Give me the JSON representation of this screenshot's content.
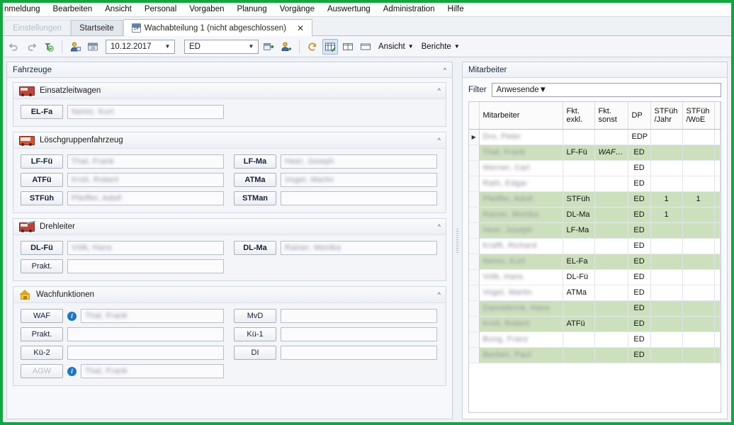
{
  "menu": {
    "items": [
      "nmeldung",
      "Bearbeiten",
      "Ansicht",
      "Personal",
      "Vorgaben",
      "Planung",
      "Vorgänge",
      "Auswertung",
      "Administration",
      "Hilfe"
    ]
  },
  "tabs": [
    {
      "label": "Einstellungen",
      "state": "ghost"
    },
    {
      "label": "Startseite",
      "state": "inactive"
    },
    {
      "label": "Wachabteilung 1 (nicht abgeschlossen)",
      "state": "active",
      "icon": "calendar-icon",
      "icon_number": "14",
      "close": "✕"
    }
  ],
  "toolbar": {
    "date_value": "10.12.2017",
    "shift_value": "ED",
    "arrow": "▼",
    "view_label": "Ansicht",
    "reports_label": "Berichte",
    "icons": [
      "undo-icon",
      "redo-icon",
      "refresh-person-icon",
      "add-person-icon",
      "calendar-assign-icon",
      "forward-day-icon",
      "person-export-icon",
      "reset-icon",
      "grid-view-icon",
      "split-view-icon",
      "single-view-icon"
    ]
  },
  "left_pane": {
    "title": "Fahrzeuge",
    "groups": [
      {
        "title": "Einsatzleitwagen",
        "icon": "fire-truck-icon",
        "rows": [
          [
            {
              "label": "EL-Fa",
              "value": "Nemo, Kurt",
              "bold": true,
              "info": false
            },
            null
          ]
        ]
      },
      {
        "title": "Löschgruppenfahrzeug",
        "icon": "fire-engine-icon",
        "rows": [
          [
            {
              "label": "LF-Fü",
              "value": "Thal, Frank",
              "bold": true,
              "info": false
            },
            {
              "label": "LF-Ma",
              "value": "Heer, Joseph",
              "bold": true,
              "info": false
            }
          ],
          [
            {
              "label": "ATFü",
              "value": "Kroll, Robert",
              "bold": true,
              "info": false
            },
            {
              "label": "ATMa",
              "value": "Vogel, Martin",
              "bold": true,
              "info": false
            }
          ],
          [
            {
              "label": "STFüh",
              "value": "Pfeiffer, Adolf",
              "bold": true,
              "info": false
            },
            {
              "label": "STMan",
              "value": "",
              "bold": true,
              "info": false
            }
          ]
        ]
      },
      {
        "title": "Drehleiter",
        "icon": "turntable-ladder-icon",
        "rows": [
          [
            {
              "label": "DL-Fü",
              "value": "Völk, Hans",
              "bold": true,
              "info": false
            },
            {
              "label": "DL-Ma",
              "value": "Rainer, Monika",
              "bold": true,
              "info": false
            }
          ],
          [
            {
              "label": "Prakt.",
              "value": "",
              "bold": false,
              "info": false
            },
            null
          ]
        ]
      },
      {
        "title": "Wachfunktionen",
        "icon": "house-icon",
        "rows": [
          [
            {
              "label": "WAF",
              "value": "Thal, Frank",
              "bold": false,
              "info": true
            },
            {
              "label": "MvD",
              "value": "",
              "bold": false,
              "info": false
            }
          ],
          [
            {
              "label": "Prakt.",
              "value": "",
              "bold": false,
              "info": false
            },
            {
              "label": "Kü-1",
              "value": "",
              "bold": false,
              "info": false
            }
          ],
          [
            {
              "label": "Kü-2",
              "value": "",
              "bold": false,
              "info": false
            },
            {
              "label": "DI",
              "value": "",
              "bold": false,
              "info": false
            }
          ],
          [
            {
              "label": "AGW",
              "value": "Thal, Frank",
              "bold": false,
              "info": true,
              "dim": true
            },
            null
          ]
        ]
      }
    ]
  },
  "right_pane": {
    "title": "Mitarbeiter",
    "filter_label": "Filter",
    "filter_value": "Anwesende",
    "table": {
      "columns": [
        "Mitarbeiter",
        "Fkt. exkl.",
        "Fkt. sonst",
        "DP",
        "STFüh /Jahr",
        "STFüh /WoE",
        ""
      ],
      "rows": [
        {
          "name": "Dro, Peter",
          "fkt_exkl": "",
          "fkt_sonst": "",
          "dp": "EDP",
          "jahr": "",
          "woe": "",
          "highlight": false,
          "current": true
        },
        {
          "name": "Thal, Frank",
          "fkt_exkl": "LF-Fü",
          "fkt_sonst": "WAF…",
          "dp": "ED",
          "jahr": "",
          "woe": "",
          "highlight": true,
          "sonst_italic": true
        },
        {
          "name": "Werner, Carl",
          "fkt_exkl": "",
          "fkt_sonst": "",
          "dp": "ED",
          "jahr": "",
          "woe": "",
          "highlight": false
        },
        {
          "name": "Rath, Edgar",
          "fkt_exkl": "",
          "fkt_sonst": "",
          "dp": "ED",
          "jahr": "",
          "woe": "",
          "highlight": false
        },
        {
          "name": "Pfeiffer, Adolf",
          "fkt_exkl": "STFüh",
          "fkt_sonst": "",
          "dp": "ED",
          "jahr": "1",
          "woe": "1",
          "highlight": true
        },
        {
          "name": "Rainer, Monika",
          "fkt_exkl": "DL-Ma",
          "fkt_sonst": "",
          "dp": "ED",
          "jahr": "1",
          "woe": "",
          "highlight": true
        },
        {
          "name": "Heer, Joseph",
          "fkt_exkl": "LF-Ma",
          "fkt_sonst": "",
          "dp": "ED",
          "jahr": "",
          "woe": "",
          "highlight": true
        },
        {
          "name": "Krafft, Richard",
          "fkt_exkl": "",
          "fkt_sonst": "",
          "dp": "ED",
          "jahr": "",
          "woe": "",
          "highlight": false
        },
        {
          "name": "Nemo, Kurt",
          "fkt_exkl": "EL-Fa",
          "fkt_sonst": "",
          "dp": "ED",
          "jahr": "",
          "woe": "",
          "highlight": true
        },
        {
          "name": "Völk, Hans",
          "fkt_exkl": "DL-Fü",
          "fkt_sonst": "",
          "dp": "ED",
          "jahr": "",
          "woe": "",
          "highlight": false
        },
        {
          "name": "Vogel, Martin",
          "fkt_exkl": "ATMa",
          "fkt_sonst": "",
          "dp": "ED",
          "jahr": "",
          "woe": "",
          "highlight": false
        },
        {
          "name": "Dannebrink, Hans",
          "fkt_exkl": "",
          "fkt_sonst": "",
          "dp": "ED",
          "jahr": "",
          "woe": "",
          "highlight": true
        },
        {
          "name": "Kroll, Robert",
          "fkt_exkl": "ATFü",
          "fkt_sonst": "",
          "dp": "ED",
          "jahr": "",
          "woe": "",
          "highlight": true
        },
        {
          "name": "Bung, Franz",
          "fkt_exkl": "",
          "fkt_sonst": "",
          "dp": "ED",
          "jahr": "",
          "woe": "",
          "highlight": false
        },
        {
          "name": "Berben, Paul",
          "fkt_exkl": "",
          "fkt_sonst": "",
          "dp": "ED",
          "jahr": "",
          "woe": "",
          "highlight": true
        }
      ]
    }
  },
  "colors": {
    "frame_green": "#13a53f",
    "row_highlight": "#cde0bd",
    "accent_blue": "#1f77bf"
  }
}
